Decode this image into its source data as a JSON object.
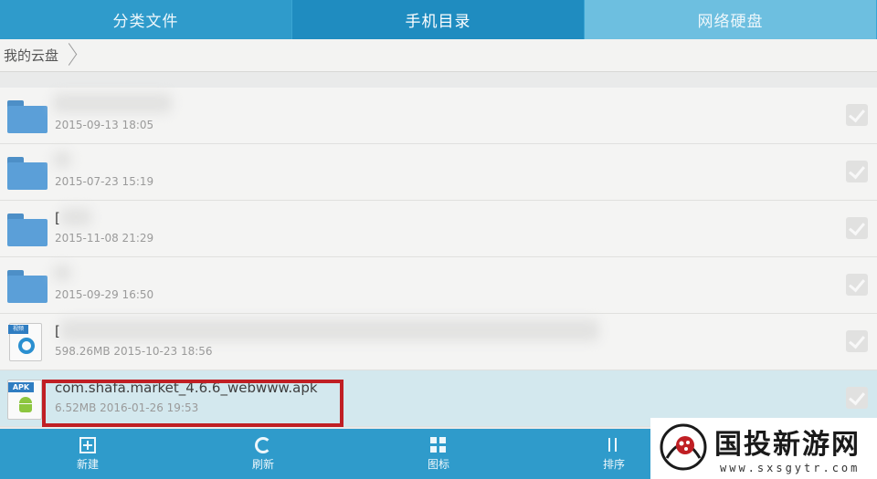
{
  "tabs": [
    {
      "label": "分类文件"
    },
    {
      "label": "手机目录"
    },
    {
      "label": "网络硬盘"
    }
  ],
  "breadcrumb": {
    "root": "我的云盘"
  },
  "files": [
    {
      "type": "folder",
      "name": "",
      "meta": "2015-09-13 18:05"
    },
    {
      "type": "folder",
      "name": "",
      "meta": "2015-07-23 15:19"
    },
    {
      "type": "folder",
      "name": "[",
      "meta": "2015-11-08 21:29"
    },
    {
      "type": "folder",
      "name": "",
      "meta": "2015-09-29 16:50"
    },
    {
      "type": "video",
      "name": "[",
      "meta": "598.26MB  2015-10-23 18:56",
      "badge": "视频"
    },
    {
      "type": "apk",
      "name": "com.shafa.market_4.6.6_webwww.apk",
      "meta": "6.52MB  2016-01-26 19:53",
      "badge": "APK"
    }
  ],
  "toolbar": {
    "new_label": "新建",
    "refresh_label": "刷新",
    "icon_label": "图标",
    "sort_label": "排序"
  },
  "watermark": {
    "title": "国投新游网",
    "url": "www.sxsgytr.com"
  },
  "colors": {
    "toolbar_blue": "#2f9bcb",
    "folder_blue": "#5b9fd8",
    "highlight_red": "#c01f24",
    "selected_row": "#d3e8ee"
  }
}
